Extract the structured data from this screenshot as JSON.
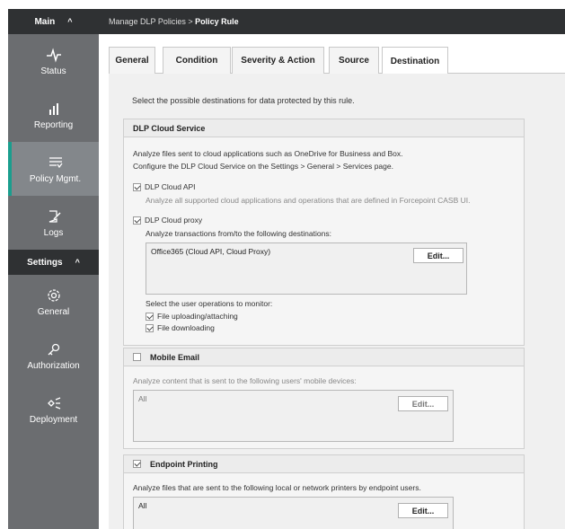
{
  "sidebar": {
    "main_header": "Main",
    "settings_header": "Settings",
    "main_items": [
      {
        "label": "Status",
        "icon": "pulse-icon"
      },
      {
        "label": "Reporting",
        "icon": "bar-chart-icon"
      },
      {
        "label": "Policy Mgmt.",
        "icon": "filter-list-icon"
      },
      {
        "label": "Logs",
        "icon": "edit-log-icon"
      }
    ],
    "settings_items": [
      {
        "label": "General",
        "icon": "gear-icon"
      },
      {
        "label": "Authorization",
        "icon": "key-icon"
      },
      {
        "label": "Deployment",
        "icon": "deploy-icon"
      }
    ],
    "accent": "#1a9e8e"
  },
  "breadcrumb": {
    "prefix": "Manage DLP Policies > ",
    "current": "Policy Rule"
  },
  "tabs": [
    "General",
    "Condition",
    "Severity & Action",
    "Source",
    "Destination"
  ],
  "active_tab": "Destination",
  "intro": "Select the possible destinations for data protected by this rule.",
  "cloud": {
    "title": "DLP Cloud Service",
    "desc1": "Analyze files sent to cloud applications such as OneDrive for Business and Box.",
    "desc2": "Configure the DLP Cloud Service on the Settings > General > Services page.",
    "api_label": "DLP Cloud API",
    "api_checked": true,
    "api_desc": "Analyze all supported cloud applications and operations that are defined in Forcepoint CASB UI.",
    "proxy_label": "DLP Cloud proxy",
    "proxy_checked": true,
    "proxy_desc": "Analyze transactions from/to the following destinations:",
    "destinations_value": "Office365 (Cloud API, Cloud Proxy)",
    "edit_label": "Edit...",
    "ops_label": "Select the user operations to monitor:",
    "op1": "File uploading/attaching",
    "op1_checked": true,
    "op2": "File downloading",
    "op2_checked": true
  },
  "mobile": {
    "title": "Mobile Email",
    "checked": false,
    "desc": "Analyze content that is sent to the following users' mobile devices:",
    "value": "All",
    "edit_label": "Edit..."
  },
  "printing": {
    "title": "Endpoint Printing",
    "checked": true,
    "desc": "Analyze files that are sent to the following local or network printers by endpoint users.",
    "value": "All",
    "edit_label": "Edit..."
  }
}
